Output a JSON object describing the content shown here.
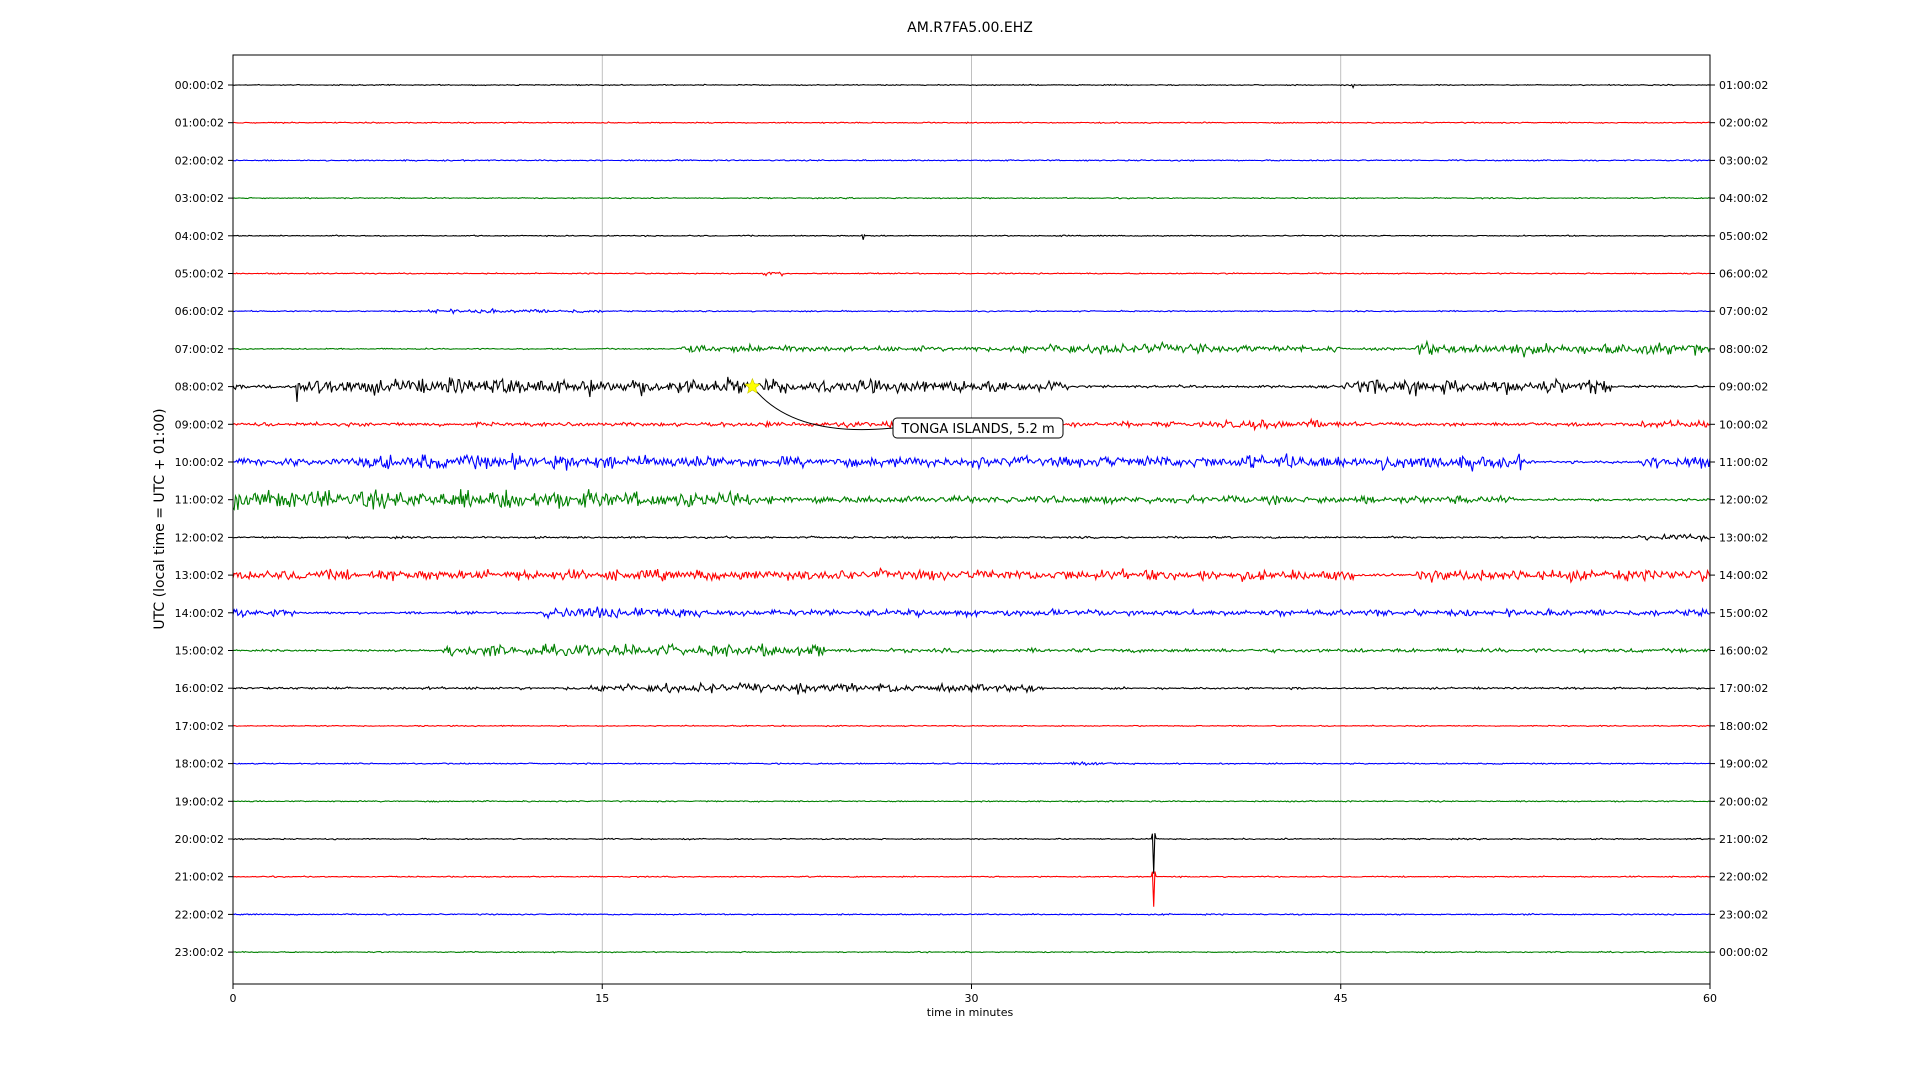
{
  "chart_data": {
    "type": "line",
    "title": "AM.R7FA5.00.EHZ",
    "xlabel": "time in minutes",
    "ylabel": "UTC (local time = UTC + 01:00)",
    "xlim": [
      0,
      60
    ],
    "xticks": [
      0,
      15,
      30,
      45,
      60
    ],
    "grid": "vertical",
    "colors": [
      "#000000",
      "#ff0000",
      "#0000ff",
      "#008000"
    ],
    "left_labels": [
      "00:00:02",
      "01:00:02",
      "02:00:02",
      "03:00:02",
      "04:00:02",
      "05:00:02",
      "06:00:02",
      "07:00:02",
      "08:00:02",
      "09:00:02",
      "10:00:02",
      "11:00:02",
      "12:00:02",
      "13:00:02",
      "14:00:02",
      "15:00:02",
      "16:00:02",
      "17:00:02",
      "18:00:02",
      "19:00:02",
      "20:00:02",
      "21:00:02",
      "22:00:02",
      "23:00:02"
    ],
    "right_labels": [
      "01:00:02",
      "02:00:02",
      "03:00:02",
      "04:00:02",
      "05:00:02",
      "06:00:02",
      "07:00:02",
      "08:00:02",
      "09:00:02",
      "10:00:02",
      "11:00:02",
      "12:00:02",
      "13:00:02",
      "14:00:02",
      "15:00:02",
      "16:00:02",
      "17:00:02",
      "18:00:02",
      "19:00:02",
      "20:00:02",
      "21:00:02",
      "22:00:02",
      "23:00:02",
      "00:00:02"
    ],
    "trace_activity": [
      [
        [
          0,
          60,
          0.8
        ]
      ],
      [
        [
          0,
          60,
          0.9
        ]
      ],
      [
        [
          0,
          60,
          1.0
        ]
      ],
      [
        [
          0,
          60,
          0.9
        ]
      ],
      [
        [
          0,
          60,
          0.9
        ]
      ],
      [
        [
          0,
          21.5,
          0.9
        ],
        [
          21.5,
          22.5,
          3
        ],
        [
          22.5,
          60,
          0.9
        ]
      ],
      [
        [
          0,
          7.5,
          1
        ],
        [
          7.5,
          15,
          3
        ],
        [
          15,
          60,
          1
        ]
      ],
      [
        [
          0,
          18,
          1
        ],
        [
          18,
          24,
          6
        ],
        [
          24,
          32,
          4
        ],
        [
          32,
          40,
          8
        ],
        [
          40,
          45,
          5
        ],
        [
          45,
          48,
          2
        ],
        [
          48,
          60,
          9
        ]
      ],
      [
        [
          0,
          2.5,
          3
        ],
        [
          2.5,
          21,
          12
        ],
        [
          21,
          34,
          10
        ],
        [
          34,
          45,
          2
        ],
        [
          45,
          56,
          11
        ],
        [
          56,
          60,
          2
        ]
      ],
      [
        [
          0,
          19,
          3
        ],
        [
          19,
          40,
          4
        ],
        [
          40,
          45,
          7
        ],
        [
          45,
          57,
          3
        ],
        [
          57,
          60,
          6
        ]
      ],
      [
        [
          0,
          5,
          6
        ],
        [
          5,
          20,
          11
        ],
        [
          20,
          35,
          8
        ],
        [
          35,
          41,
          9
        ],
        [
          41,
          52.5,
          11
        ],
        [
          52.5,
          57,
          2
        ],
        [
          57,
          60,
          10
        ]
      ],
      [
        [
          0,
          15,
          14
        ],
        [
          15,
          21,
          12
        ],
        [
          21,
          52,
          6
        ],
        [
          52,
          60,
          2
        ]
      ],
      [
        [
          0,
          57,
          1.5
        ],
        [
          57,
          60,
          5
        ]
      ],
      [
        [
          0,
          45.5,
          8
        ],
        [
          45.5,
          48,
          2
        ],
        [
          48,
          60,
          9
        ]
      ],
      [
        [
          0,
          2.5,
          6
        ],
        [
          2.5,
          12.5,
          2
        ],
        [
          12.5,
          19,
          9
        ],
        [
          19,
          60,
          5
        ]
      ],
      [
        [
          0,
          8.5,
          1.5
        ],
        [
          8.5,
          24,
          9
        ],
        [
          24,
          60,
          3
        ]
      ],
      [
        [
          0,
          14.5,
          2
        ],
        [
          14.5,
          28,
          7
        ],
        [
          28,
          33,
          6
        ],
        [
          33,
          60,
          1.5
        ]
      ],
      [
        [
          0,
          60,
          0.9
        ]
      ],
      [
        [
          0,
          33.5,
          1
        ],
        [
          33.5,
          36,
          3
        ],
        [
          36,
          60,
          1
        ]
      ],
      [
        [
          0,
          60,
          1
        ]
      ],
      [
        [
          0,
          60,
          1
        ]
      ],
      [
        [
          0,
          60,
          0.9
        ]
      ],
      [
        [
          0,
          60,
          1
        ]
      ],
      [
        [
          0,
          60,
          0.9
        ]
      ]
    ],
    "spikes": [
      {
        "trace": 0,
        "t": 45.5,
        "amp": 3
      },
      {
        "trace": 4,
        "t": 25.6,
        "amp": 4
      },
      {
        "trace": 8,
        "t": 2.6,
        "amp": 14
      },
      {
        "trace": 20,
        "t": 37.4,
        "amp": 35
      },
      {
        "trace": 21,
        "t": 37.4,
        "amp": 30
      }
    ],
    "annotations": [
      {
        "text": "TONGA ISLANDS, 5.2 m",
        "trace": 8,
        "t": 21.1,
        "marker": "star",
        "marker_color": "#ffff00"
      }
    ]
  }
}
